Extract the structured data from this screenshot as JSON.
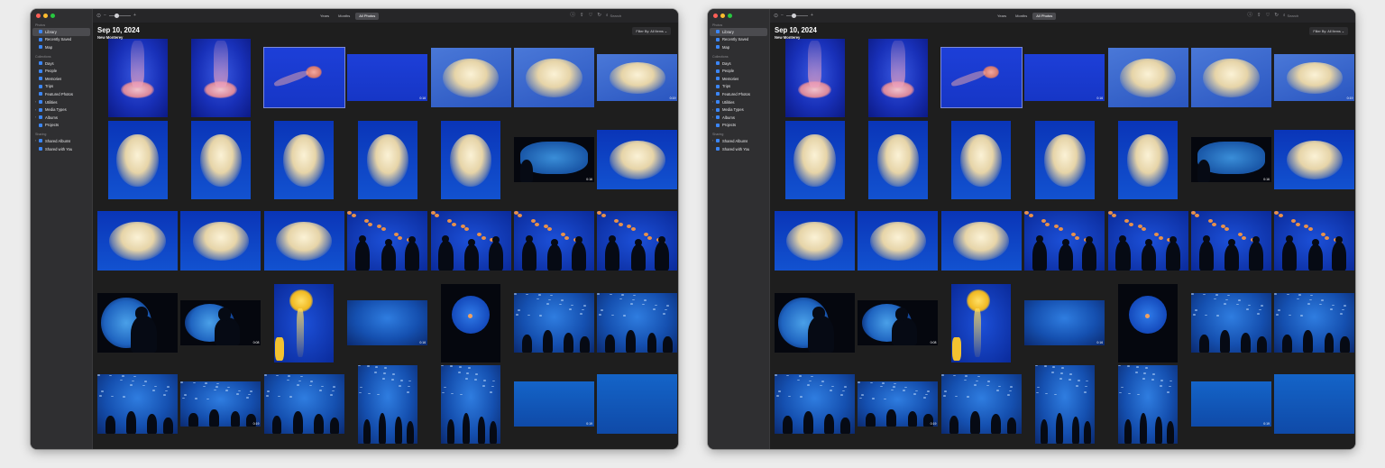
{
  "sidebar": {
    "sections": [
      {
        "title": "Photos",
        "items": [
          {
            "label": "Library",
            "selected": true
          },
          {
            "label": "Recently Saved"
          },
          {
            "label": "Map"
          }
        ]
      },
      {
        "title": "Collections",
        "items": [
          {
            "label": "Days"
          },
          {
            "label": "People"
          },
          {
            "label": "Memories"
          },
          {
            "label": "Trips"
          },
          {
            "label": "Featured Photos"
          },
          {
            "label": "Utilities",
            "chevron": true
          },
          {
            "label": "Media Types",
            "chevron": true
          },
          {
            "label": "Albums",
            "chevron": true
          },
          {
            "label": "Projects"
          }
        ]
      },
      {
        "title": "Sharing",
        "items": [
          {
            "label": "Shared Albums",
            "chevron": true
          },
          {
            "label": "Shared with You"
          }
        ]
      }
    ]
  },
  "toolbar": {
    "view_tabs": [
      {
        "label": "Years"
      },
      {
        "label": "Months"
      },
      {
        "label": "All Photos",
        "active": true
      }
    ],
    "zoom_level": 0.35,
    "search_placeholder": "Search"
  },
  "grid": {
    "date": "Sep 10, 2024",
    "location": "New Monterey",
    "filter_label": "Filter By: All Items ⌄",
    "photos": [
      {
        "style": "p-pink",
        "kind": "pink-jelly"
      },
      {
        "style": "p-pink",
        "kind": "pink-jelly"
      },
      {
        "style": "p-blue",
        "kind": "small-pink",
        "selected": true
      },
      {
        "style": "p-blue",
        "kind": "plain",
        "duration": "0:16"
      },
      {
        "style": "p-cream",
        "kind": "cream-jelly"
      },
      {
        "style": "p-cream",
        "kind": "cream-jelly"
      },
      {
        "style": "p-cream",
        "kind": "cream-jelly",
        "duration": "0:19"
      },
      {
        "style": "p-deep",
        "kind": "cream-jelly"
      },
      {
        "style": "p-deep",
        "kind": "cream-jelly"
      },
      {
        "style": "p-deep",
        "kind": "cream-jelly"
      },
      {
        "style": "p-deep",
        "kind": "cream-jelly"
      },
      {
        "style": "p-deep",
        "kind": "cream-jelly"
      },
      {
        "style": "p-dark",
        "kind": "window-sil",
        "duration": "0:16"
      },
      {
        "style": "p-deep",
        "kind": "cream-jelly"
      },
      {
        "style": "p-deep",
        "kind": "cream-jelly"
      },
      {
        "style": "p-deep",
        "kind": "cream-jelly"
      },
      {
        "style": "p-deep",
        "kind": "cream-jelly"
      },
      {
        "style": "p-amber",
        "kind": "amber-sil"
      },
      {
        "style": "p-amber",
        "kind": "amber-sil"
      },
      {
        "style": "p-amber",
        "kind": "amber-sil"
      },
      {
        "style": "p-amber",
        "kind": "amber-sil"
      },
      {
        "style": "p-dark",
        "kind": "porthole"
      },
      {
        "style": "p-dark",
        "kind": "porthole",
        "duration": "0:08"
      },
      {
        "style": "p-amber",
        "kind": "yellow-jelly"
      },
      {
        "style": "p-tank",
        "kind": "plain",
        "duration": "0:16"
      },
      {
        "style": "p-dark",
        "kind": "round-window"
      },
      {
        "style": "p-tank",
        "kind": "tank-sil"
      },
      {
        "style": "p-tank",
        "kind": "tank-sil"
      },
      {
        "style": "p-tank",
        "kind": "tank-sil"
      },
      {
        "style": "p-tank",
        "kind": "tank-sil",
        "duration": "0:19"
      },
      {
        "style": "p-tank",
        "kind": "tank-sil"
      },
      {
        "style": "p-tank",
        "kind": "tank-sil"
      },
      {
        "style": "p-tank",
        "kind": "tank-sil"
      },
      {
        "style": "p-sea",
        "kind": "plain",
        "duration": "0:19"
      },
      {
        "style": "p-sea",
        "kind": "plain"
      }
    ]
  },
  "colors": {
    "window_bg": "#1e1e1e",
    "sidebar_bg": "#2f2f31",
    "selection": "#4b4b4f",
    "accent": "#3b86f7"
  }
}
